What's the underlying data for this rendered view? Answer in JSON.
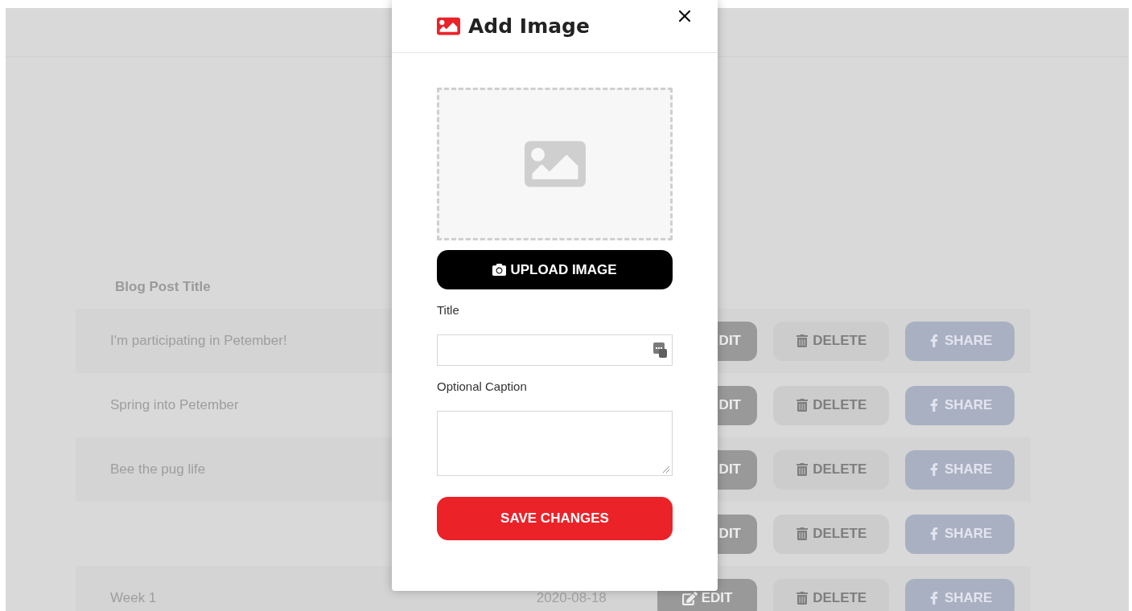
{
  "modal": {
    "title": "Add Image",
    "upload_button": "UPLOAD IMAGE",
    "fields": [
      {
        "label": "Title",
        "kind": "input"
      },
      {
        "label": "Optional Caption",
        "kind": "textarea"
      }
    ],
    "save_button": "SAVE CHANGES"
  },
  "table": {
    "columns": [
      "Blog Post Title"
    ],
    "rows": [
      {
        "title": "I'm participating in Petember!",
        "edit": "DIT",
        "edit_icon": false,
        "delete": "DELETE",
        "share": "SHARE"
      },
      {
        "title": "Spring into Petember",
        "edit": "DIT",
        "edit_icon": false,
        "delete": "DELETE",
        "share": "SHARE"
      },
      {
        "title": "Bee the pug life",
        "edit": "DIT",
        "edit_icon": false,
        "delete": "DELETE",
        "share": "SHARE"
      },
      {
        "edit": "DIT",
        "edit_icon": false,
        "delete": "DELETE",
        "share": "SHARE"
      },
      {
        "title": "Week 1",
        "date": "2020-08-18",
        "edit": "EDIT",
        "edit_icon": true,
        "delete": "DELETE",
        "share": "SHARE"
      }
    ]
  }
}
